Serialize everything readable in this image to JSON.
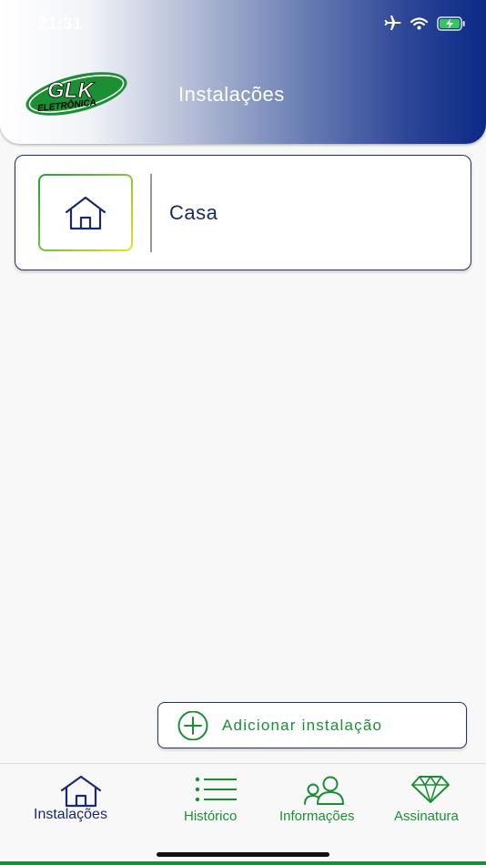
{
  "status_bar": {
    "time": "21:31",
    "icons": [
      "airplane-icon",
      "wifi-icon",
      "battery-charging-icon"
    ]
  },
  "header": {
    "logo_text_main": "GLK",
    "logo_text_sub": "ELETRÔNICA",
    "title": "Instalações"
  },
  "installations": [
    {
      "label": "Casa",
      "icon": "house-icon"
    }
  ],
  "add_button": {
    "label": "Adicionar instalação",
    "icon": "plus-circle-icon"
  },
  "tabbar": {
    "tabs": [
      {
        "label": "Instalações",
        "icon": "house-icon",
        "active": true
      },
      {
        "label": "Histórico",
        "icon": "list-icon",
        "active": false
      },
      {
        "label": "Informações",
        "icon": "users-icon",
        "active": false
      },
      {
        "label": "Assinatura",
        "icon": "diamond-icon",
        "active": false
      }
    ]
  },
  "colors": {
    "brand_blue": "#1a2a6b",
    "brand_green": "#1c8f35",
    "header_gradient_end": "#0b2a86"
  }
}
